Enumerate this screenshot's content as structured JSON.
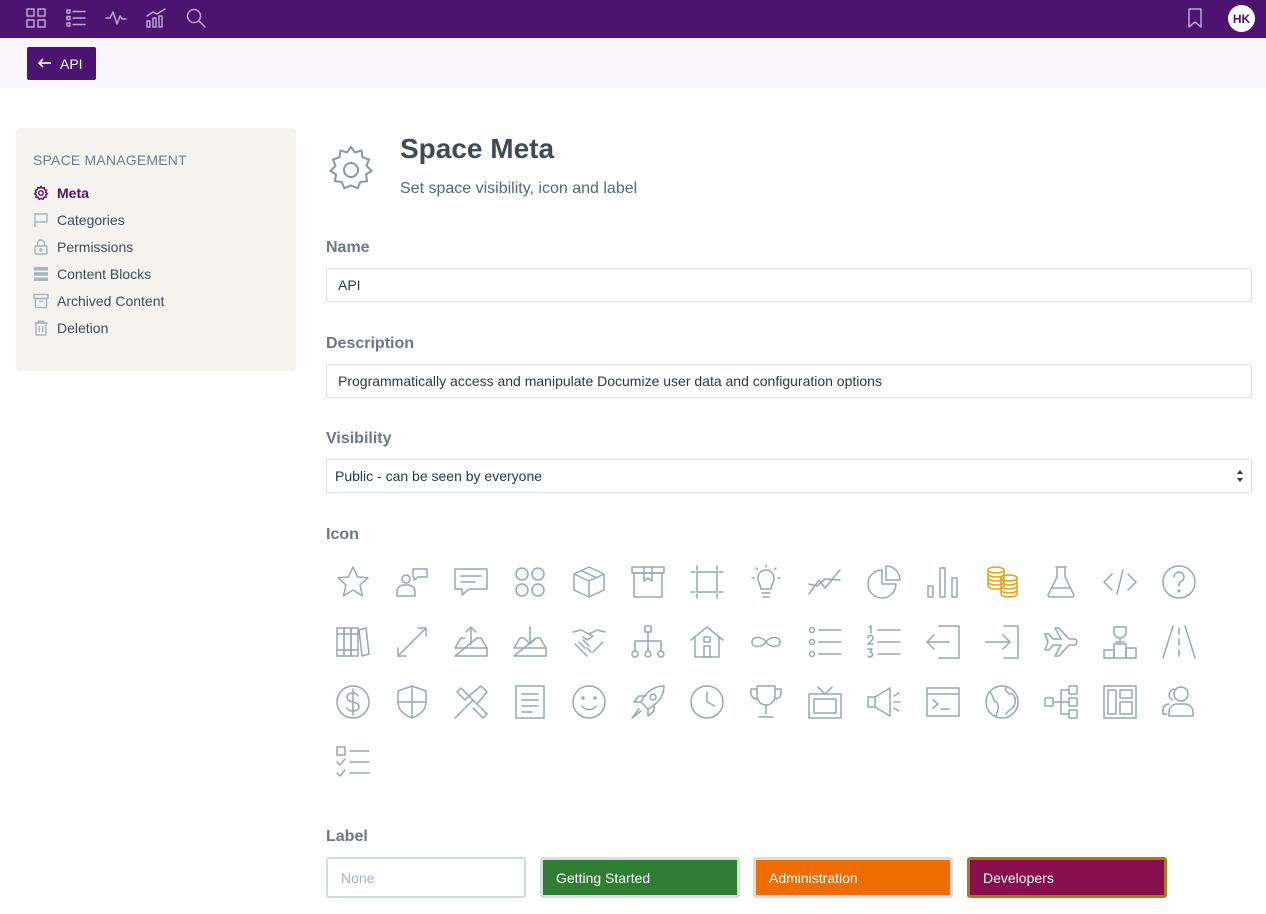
{
  "topbar": {
    "icons": [
      "grid-icon",
      "list-icon",
      "activity-icon",
      "analytics-icon",
      "search-icon"
    ],
    "bookmark_icon": "bookmark-icon",
    "avatar_initials": "HK",
    "color": "#4c1370"
  },
  "back_button": {
    "label": "API",
    "icon": "arrow-left-icon"
  },
  "sidebar": {
    "title": "SPACE MANAGEMENT",
    "items": [
      {
        "label": "Meta",
        "icon": "gear-icon",
        "active": true
      },
      {
        "label": "Categories",
        "icon": "flag-icon"
      },
      {
        "label": "Permissions",
        "icon": "lock-icon"
      },
      {
        "label": "Content Blocks",
        "icon": "blocks-icon"
      },
      {
        "label": "Archived Content",
        "icon": "archive-icon"
      },
      {
        "label": "Deletion",
        "icon": "trash-icon"
      }
    ]
  },
  "header": {
    "icon": "gear-icon",
    "title": "Space Meta",
    "subtitle": "Set space visibility, icon and label"
  },
  "form": {
    "name": {
      "label": "Name",
      "value": "API"
    },
    "description": {
      "label": "Description",
      "value": "Programmatically access and manipulate Documize user data and configuration options"
    },
    "visibility": {
      "label": "Visibility",
      "value": "Public - can be seen by everyone"
    },
    "icon": {
      "label": "Icon",
      "selected": "coins-icon",
      "selected_color": "#e8a317",
      "options": [
        "star-icon",
        "user-chat-icon",
        "chat-icon",
        "apps-icon",
        "box-icon",
        "package-icon",
        "crop-icon",
        "bulb-icon",
        "line-chart-icon",
        "pie-chart-icon",
        "bar-chart-icon",
        "coins-icon",
        "flask-icon",
        "code-icon",
        "question-icon",
        "books-icon",
        "transfer-icon",
        "upload-icon",
        "download-icon",
        "handshake-icon",
        "hierarchy-icon",
        "house-icon",
        "infinity-icon",
        "bullet-list-icon",
        "numbered-list-icon",
        "logout-icon",
        "login-icon",
        "airplane-icon",
        "podium-icon",
        "road-icon",
        "dollar-icon",
        "shield-icon",
        "tools-icon",
        "document-icon",
        "smiley-icon",
        "rocket-icon",
        "clock-icon",
        "trophy-icon",
        "tv-icon",
        "megaphone-icon",
        "terminal-icon",
        "globe-icon",
        "flowchart-icon",
        "layout-icon",
        "users-icon",
        "checklist-icon"
      ]
    },
    "label": {
      "label": "Label",
      "options": [
        {
          "name": "None",
          "color": ""
        },
        {
          "name": "Getting Started",
          "color": "#2e7d32"
        },
        {
          "name": "Administration",
          "color": "#ef6c00"
        },
        {
          "name": "Developers",
          "color": "#880e4f",
          "selected": true
        }
      ]
    }
  }
}
